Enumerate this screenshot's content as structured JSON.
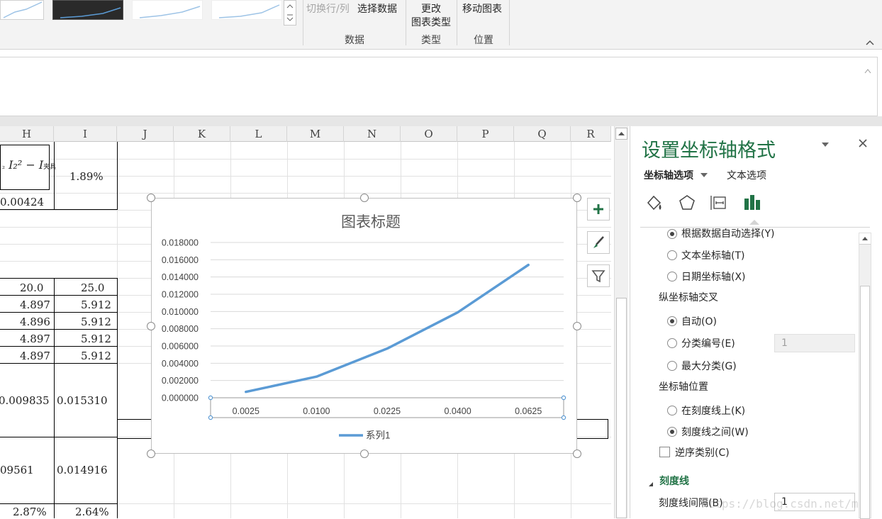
{
  "ribbon": {
    "switch_row_col": "切换行/列",
    "select_data": "选择数据",
    "change_type_line1": "更改",
    "change_type_line2": "图表类型",
    "move_chart": "移动图表",
    "groups": {
      "data": "数据",
      "type": "类型",
      "location": "位置"
    }
  },
  "sheet": {
    "columns": [
      "H",
      "I",
      "J",
      "K",
      "L",
      "M",
      "N",
      "O",
      "P",
      "Q",
      "R"
    ],
    "cells": {
      "h_value_small": "0.00424",
      "i_percent_top": "1.89%",
      "row_values": [
        {
          "h": "20.0",
          "i": "25.0"
        },
        {
          "h": "4.897",
          "i": "5.912"
        },
        {
          "h": "4.896",
          "i": "5.912"
        },
        {
          "h": "4.897",
          "i": "5.912"
        },
        {
          "h": "4.897",
          "i": "5.912"
        }
      ],
      "h_value_a": "0.009835",
      "i_value_a": "0.015310",
      "h_value_b": "09561",
      "i_value_b": "0.014916",
      "h_percent_bottom": "2.87%",
      "i_percent_bottom": "2.64%"
    },
    "formula_tail": "I₂² − I",
    "formula_sub": "",
    "formula_sub_label": "₂",
    "formula_sub_box": "夹具"
  },
  "chart_data": {
    "type": "line",
    "title": "图表标题",
    "categories": [
      "0.0025",
      "0.0100",
      "0.0225",
      "0.0400",
      "0.0625"
    ],
    "series": [
      {
        "name": "系列1",
        "values": [
          0.00068,
          0.00245,
          0.0057,
          0.0099,
          0.0154
        ],
        "color": "#5b9bd5"
      }
    ],
    "yticks": [
      "0.018000",
      "0.016000",
      "0.014000",
      "0.012000",
      "0.010000",
      "0.008000",
      "0.006000",
      "0.004000",
      "0.002000",
      "0.000000"
    ],
    "ylim": [
      0,
      0.018
    ],
    "grid": true,
    "legend": "bottom"
  },
  "pane": {
    "title": "设置坐标轴格式",
    "tab_axis_options": "坐标轴选项",
    "tab_text_options": "文本选项",
    "axis_type": [
      {
        "label": "根据数据自动选择(Y)",
        "checked": true
      },
      {
        "label": "文本坐标轴(T)",
        "checked": false
      },
      {
        "label": "日期坐标轴(X)",
        "checked": false
      }
    ],
    "cross_title": "纵坐标轴交叉",
    "cross": [
      {
        "label": "自动(O)",
        "checked": true
      },
      {
        "label": "分类编号(E)",
        "checked": false
      },
      {
        "label": "最大分类(G)",
        "checked": false
      }
    ],
    "cross_value": "1",
    "position_title": "坐标轴位置",
    "position": [
      {
        "label": "在刻度线上(K)",
        "checked": false
      },
      {
        "label": "刻度线之间(W)",
        "checked": true
      }
    ],
    "reverse_label": "逆序类别(C)",
    "tick_section": "刻度线",
    "tick_interval_label": "刻度线间隔(B)",
    "tick_interval_value": "1",
    "watermark": "https://blog.csdn.net/man_zuo"
  },
  "icons": [
    "fill-line-icon",
    "effects-icon",
    "size-properties-icon",
    "axis-options-icon",
    "chart-elements-icon",
    "chart-styles-icon",
    "chart-filters-icon",
    "close-icon",
    "dropdown-icon"
  ],
  "colors": {
    "accent": "#217346",
    "series": "#5b9bd5"
  }
}
